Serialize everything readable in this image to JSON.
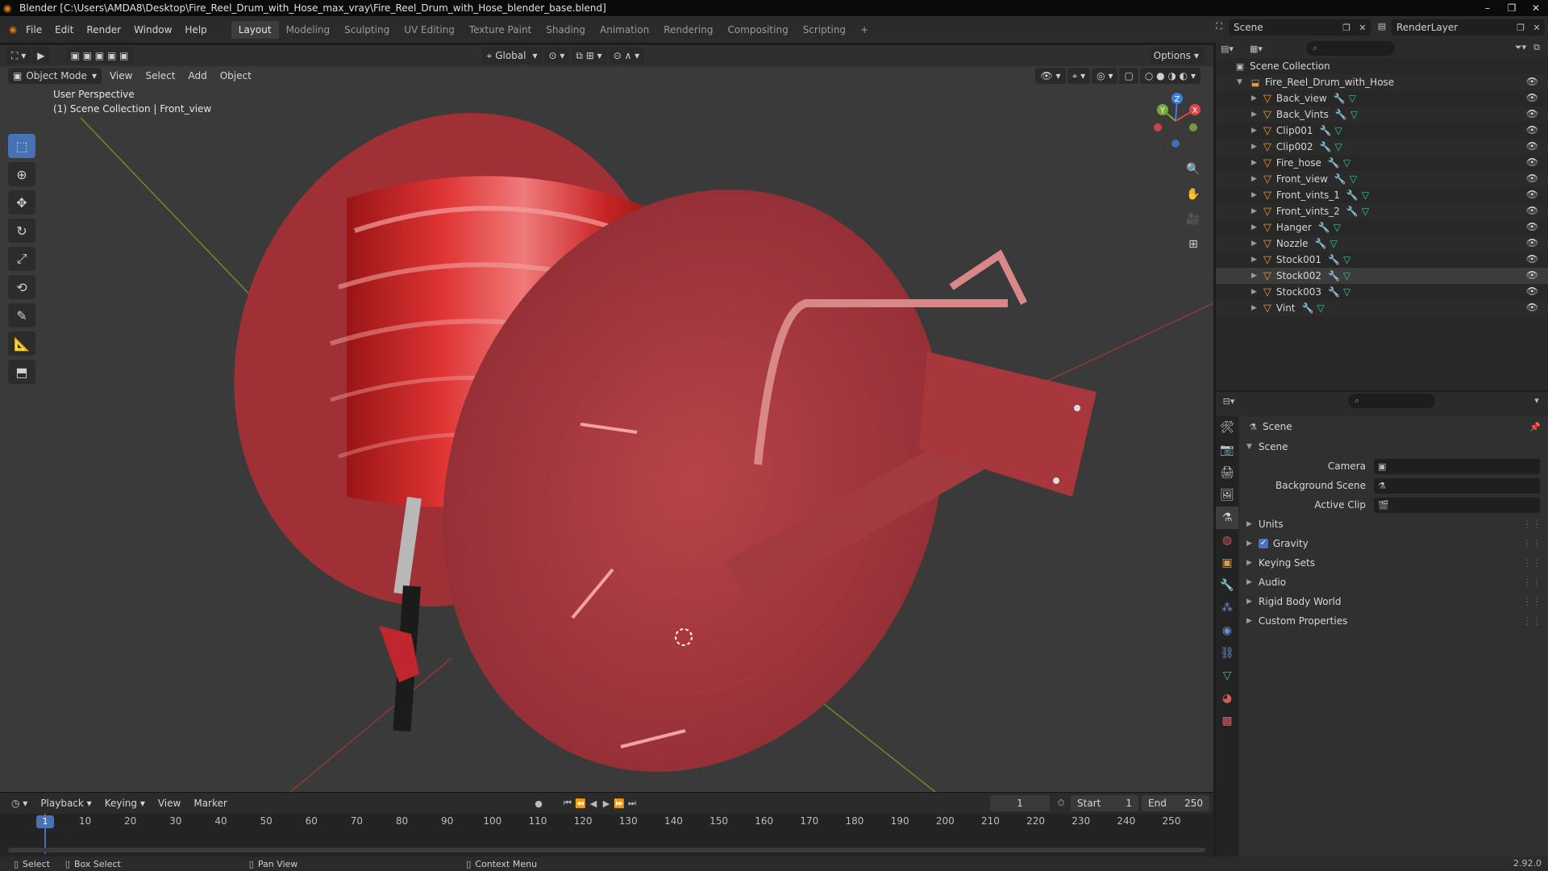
{
  "window": {
    "title": "Blender [C:\\Users\\AMDA8\\Desktop\\Fire_Reel_Drum_with_Hose_max_vray\\Fire_Reel_Drum_with_Hose_blender_base.blend]",
    "controls": [
      "–",
      "❐",
      "✕"
    ]
  },
  "menu": [
    "File",
    "Edit",
    "Render",
    "Window",
    "Help"
  ],
  "workspaces": [
    "Layout",
    "Modeling",
    "Sculpting",
    "UV Editing",
    "Texture Paint",
    "Shading",
    "Animation",
    "Rendering",
    "Compositing",
    "Scripting",
    "+"
  ],
  "scene_selector": "Scene",
  "view_layer_selector": "RenderLayer",
  "viewport": {
    "transform_orientation": "Global",
    "options_label": "Options",
    "mode": "Object Mode",
    "header_menus": [
      "View",
      "Select",
      "Add",
      "Object"
    ],
    "info_line1": "User Perspective",
    "info_line2": "(1) Scene Collection | Front_view",
    "gizmo": {
      "z": "Z",
      "y": "Y",
      "x": "X"
    }
  },
  "timeline": {
    "menus": [
      "Playback",
      "Keying",
      "View",
      "Marker"
    ],
    "current_frame": "1",
    "start_label": "Start",
    "start": "1",
    "end_label": "End",
    "end": "250",
    "ticks": [
      "10",
      "20",
      "30",
      "40",
      "50",
      "60",
      "70",
      "80",
      "90",
      "100",
      "110",
      "120",
      "130",
      "140",
      "150",
      "160",
      "170",
      "180",
      "190",
      "200",
      "210",
      "220",
      "230",
      "240",
      "250"
    ],
    "cursor_label": "1"
  },
  "statusbar": {
    "select": "Select",
    "box_select": "Box Select",
    "pan_view": "Pan View",
    "context_menu": "Context Menu",
    "version": "2.92.0"
  },
  "outliner": {
    "root": "Scene Collection",
    "collection": "Fire_Reel_Drum_with_Hose",
    "objects": [
      "Back_view",
      "Back_Vints",
      "Clip001",
      "Clip002",
      "Fire_hose",
      "Front_view",
      "Front_vints_1",
      "Front_vints_2",
      "Hanger",
      "Nozzle",
      "Stock001",
      "Stock002",
      "Stock003",
      "Vint"
    ],
    "selected": "Stock002"
  },
  "properties": {
    "context": "Scene",
    "panel_title": "Scene",
    "fields": [
      {
        "label": "Camera",
        "value": ""
      },
      {
        "label": "Background Scene",
        "value": ""
      },
      {
        "label": "Active Clip",
        "value": ""
      }
    ],
    "subpanels": [
      "Units",
      "Gravity",
      "Keying Sets",
      "Audio",
      "Rigid Body World",
      "Custom Properties"
    ]
  },
  "colors": {
    "accent": "#4772b3",
    "object": "#e69a38",
    "reel": "#b3373a",
    "hose": "#d82a2a"
  }
}
